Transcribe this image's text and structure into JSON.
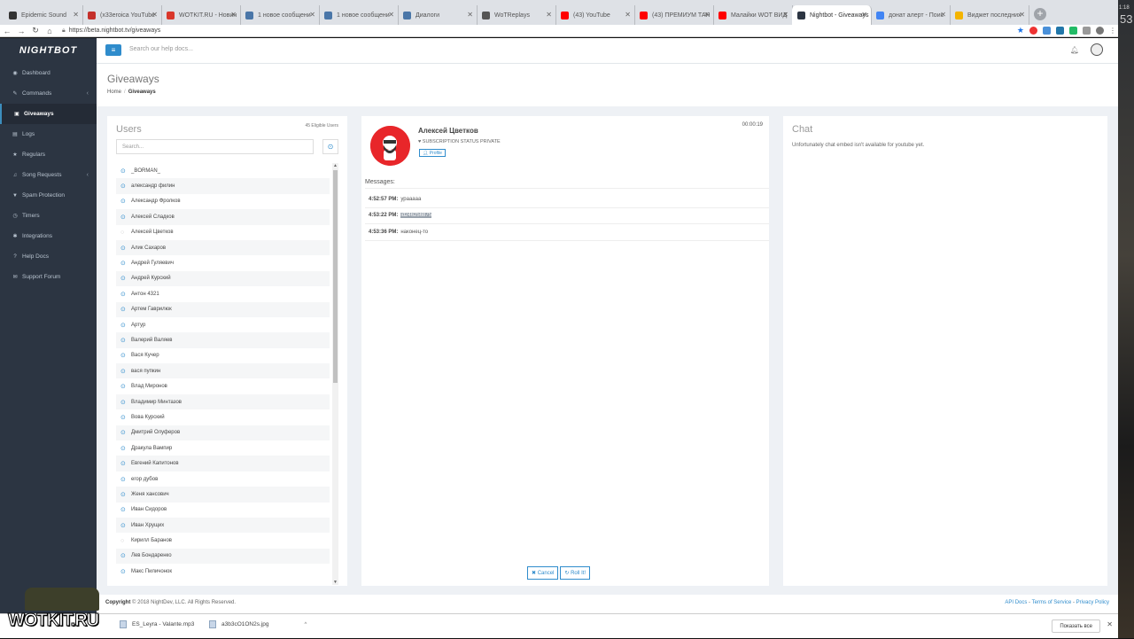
{
  "browser": {
    "tabs": [
      {
        "label": "Epidemic Sound",
        "color": "#333333"
      },
      {
        "label": "(x33eroica YouTube",
        "color": "#c4302b"
      },
      {
        "label": "WOTKIT.RU - Новин",
        "color": "#d9372b"
      },
      {
        "label": "1 новое сообщени",
        "color": "#4a76a8"
      },
      {
        "label": "1 новое сообщени",
        "color": "#4a76a8"
      },
      {
        "label": "Диалоги",
        "color": "#4a76a8"
      },
      {
        "label": "WoTReplays",
        "color": "#555555"
      },
      {
        "label": "(43) YouTube",
        "color": "#ff0000"
      },
      {
        "label": "(43) ПРЕМИУМ ТАН",
        "color": "#ff0000"
      },
      {
        "label": "Малайки WOT ВИД",
        "color": "#ff0000"
      },
      {
        "label": "Nightbot - Giveaways",
        "color": "#2c3542",
        "active": true
      },
      {
        "label": "донат алерт - Поис",
        "color": "#4285f4"
      },
      {
        "label": "Виджет последних",
        "color": "#f4b400"
      }
    ],
    "url": "https://beta.nightbot.tv/giveaways"
  },
  "desktop": {
    "clock": "1:18",
    "big": "53"
  },
  "sidebar": {
    "logo": "NIGHTBOT",
    "items": [
      {
        "label": "Dashboard",
        "icon": "dashboard-icon",
        "glyph": "◉"
      },
      {
        "label": "Commands",
        "icon": "wrench-icon",
        "glyph": "✎",
        "chevron": true
      },
      {
        "label": "Giveaways",
        "icon": "gift-icon",
        "glyph": "▣",
        "active": true
      },
      {
        "label": "Logs",
        "icon": "logs-icon",
        "glyph": "▤"
      },
      {
        "label": "Regulars",
        "icon": "star-icon",
        "glyph": "★"
      },
      {
        "label": "Song Requests",
        "icon": "music-icon",
        "glyph": "♫",
        "chevron": true
      },
      {
        "label": "Spam Protection",
        "icon": "filter-icon",
        "glyph": "▼"
      },
      {
        "label": "Timers",
        "icon": "clock-icon",
        "glyph": "◷"
      },
      {
        "label": "Integrations",
        "icon": "plug-icon",
        "glyph": "✱"
      },
      {
        "label": "Help Docs",
        "icon": "book-icon",
        "glyph": "?"
      },
      {
        "label": "Support Forum",
        "icon": "comments-icon",
        "glyph": "✉"
      }
    ]
  },
  "topbar": {
    "search_placeholder": "Search our help docs..."
  },
  "page": {
    "title": "Giveaways",
    "breadcrumb": {
      "home": "Home",
      "current": "Giveaways"
    }
  },
  "users": {
    "title": "Users",
    "eligible": "45 Eligible Users",
    "search_placeholder": "Search...",
    "list": [
      {
        "name": "_BORMAN_",
        "on": true
      },
      {
        "name": "александр филин",
        "on": true
      },
      {
        "name": "Александр Фролков",
        "on": true
      },
      {
        "name": "Алексей Сладков",
        "on": true
      },
      {
        "name": "Алексей Цветков",
        "on": false
      },
      {
        "name": "Алик Сахаров",
        "on": true
      },
      {
        "name": "Андрей Гуляевич",
        "on": true
      },
      {
        "name": "Андрей Курский",
        "on": true
      },
      {
        "name": "Антон 4321",
        "on": true
      },
      {
        "name": "Артем Гаврилюк",
        "on": true
      },
      {
        "name": "Артур",
        "on": true
      },
      {
        "name": "Валерий Валяев",
        "on": true
      },
      {
        "name": "Вася Кучер",
        "on": true
      },
      {
        "name": "вася пупкин",
        "on": true
      },
      {
        "name": "Влад Миронов",
        "on": true
      },
      {
        "name": "Владимир Минтазов",
        "on": true
      },
      {
        "name": "Вова Курский",
        "on": true
      },
      {
        "name": "Дмитрий Олуферов",
        "on": true
      },
      {
        "name": "Дракула Вампир",
        "on": true
      },
      {
        "name": "Евгений Капитонов",
        "on": true
      },
      {
        "name": "егор дубов",
        "on": true
      },
      {
        "name": "Женя хансович",
        "on": true
      },
      {
        "name": "Иван Сидоров",
        "on": true
      },
      {
        "name": "Иван Хрущих",
        "on": true
      },
      {
        "name": "Кирилл Баранов",
        "on": false
      },
      {
        "name": "Лев Бондаренко",
        "on": true
      },
      {
        "name": "Макс Пиличонок",
        "on": true
      }
    ]
  },
  "winner": {
    "name": "Алексей Цветков",
    "status": "SUBSCRIPTION STATUS PRIVATE",
    "profile_label": "Profile",
    "timer": "00:00:19",
    "messages_label": "Messages:",
    "messages": [
      {
        "time": "4:52:57 PM:",
        "text": "урааааа",
        "highlight": ""
      },
      {
        "time": "4:53:22 PM:",
        "text": "",
        "highlight": "id246256875"
      },
      {
        "time": "4:53:36 PM:",
        "text": "наконец-то",
        "highlight": ""
      }
    ],
    "cancel_label": "✖ Cancel",
    "roll_label": "↻ Roll It!"
  },
  "chat": {
    "title": "Chat",
    "text": "Unfortunately chat embed isn't available for youtube yet."
  },
  "footer": {
    "copyright_label": "Copyright",
    "copyright_text": "© 2018 NightDev, LLC. All Rights Reserved.",
    "links": [
      "API Docs",
      "Terms of Service",
      "Privacy Policy"
    ]
  },
  "downloads": {
    "items": [
      "ES_Leyra - Valante.mp3",
      "a3b3cO1ON2s.jpg"
    ],
    "show_all": "Показать все",
    "watermark": "WOTKIT.RU"
  }
}
